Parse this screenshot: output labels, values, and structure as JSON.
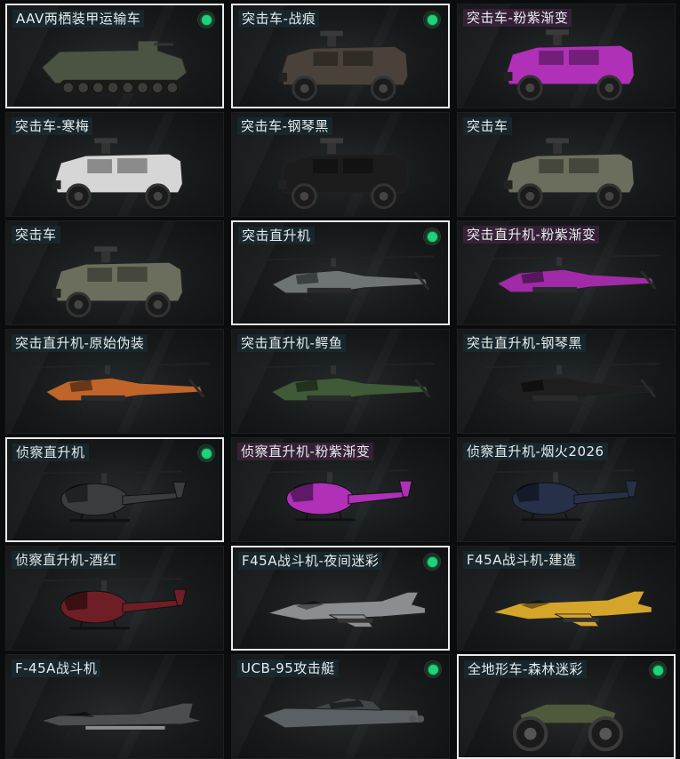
{
  "items": [
    {
      "label": "AAV两栖装甲运输车",
      "owned": true,
      "selected": true,
      "kind": "amphib",
      "color": "#4b5443"
    },
    {
      "label": "突击车-战痕",
      "owned": true,
      "selected": true,
      "kind": "truck",
      "color": "#4a423a"
    },
    {
      "label": "突击车-粉紫渐变",
      "owned": false,
      "selected": false,
      "kind": "truck",
      "color": "#b030b8"
    },
    {
      "label": "突击车-寒梅",
      "owned": false,
      "selected": false,
      "kind": "truck",
      "color": "#d6d6d6"
    },
    {
      "label": "突击车-钢琴黑",
      "owned": false,
      "selected": false,
      "kind": "truck",
      "color": "#1c1c1c"
    },
    {
      "label": "突击车",
      "owned": false,
      "selected": false,
      "kind": "truck",
      "color": "#6b6e5c"
    },
    {
      "label": "突击车",
      "owned": false,
      "selected": false,
      "kind": "truck",
      "color": "#6b6e5c"
    },
    {
      "label": "突击直升机",
      "owned": true,
      "selected": true,
      "kind": "attack-heli",
      "color": "#6e7376"
    },
    {
      "label": "突击直升机-粉紫渐变",
      "owned": false,
      "selected": false,
      "kind": "attack-heli",
      "color": "#a02aa8"
    },
    {
      "label": "突击直升机-原始伪装",
      "owned": false,
      "selected": false,
      "kind": "attack-heli",
      "color": "#c0642a"
    },
    {
      "label": "突击直升机-鳄鱼",
      "owned": false,
      "selected": false,
      "kind": "attack-heli",
      "color": "#3e5a36"
    },
    {
      "label": "突击直升机-钢琴黑",
      "owned": false,
      "selected": false,
      "kind": "attack-heli",
      "color": "#1e1e1e"
    },
    {
      "label": "侦察直升机",
      "owned": true,
      "selected": true,
      "kind": "scout-heli",
      "color": "#3a3d3f"
    },
    {
      "label": "侦察直升机-粉紫渐变",
      "owned": false,
      "selected": false,
      "kind": "scout-heli",
      "color": "#b030b8"
    },
    {
      "label": "侦察直升机-烟火2026",
      "owned": false,
      "selected": false,
      "kind": "scout-heli",
      "color": "#263048"
    },
    {
      "label": "侦察直升机-酒红",
      "owned": false,
      "selected": false,
      "kind": "scout-heli",
      "color": "#6e1e24"
    },
    {
      "label": "F45A战斗机-夜间迷彩",
      "owned": true,
      "selected": true,
      "kind": "jet",
      "color": "#8a8e90"
    },
    {
      "label": "F45A战斗机-建造",
      "owned": false,
      "selected": false,
      "kind": "jet",
      "color": "#d4a52a"
    },
    {
      "label": "F-45A战斗机",
      "owned": false,
      "selected": false,
      "kind": "jet-side",
      "color": "#4a4e50"
    },
    {
      "label": "UCB-95攻击艇",
      "owned": true,
      "selected": false,
      "kind": "boat",
      "color": "#5a6064"
    },
    {
      "label": "全地形车-森林迷彩",
      "owned": true,
      "selected": true,
      "kind": "atv",
      "color": "#4e5a3a"
    }
  ]
}
